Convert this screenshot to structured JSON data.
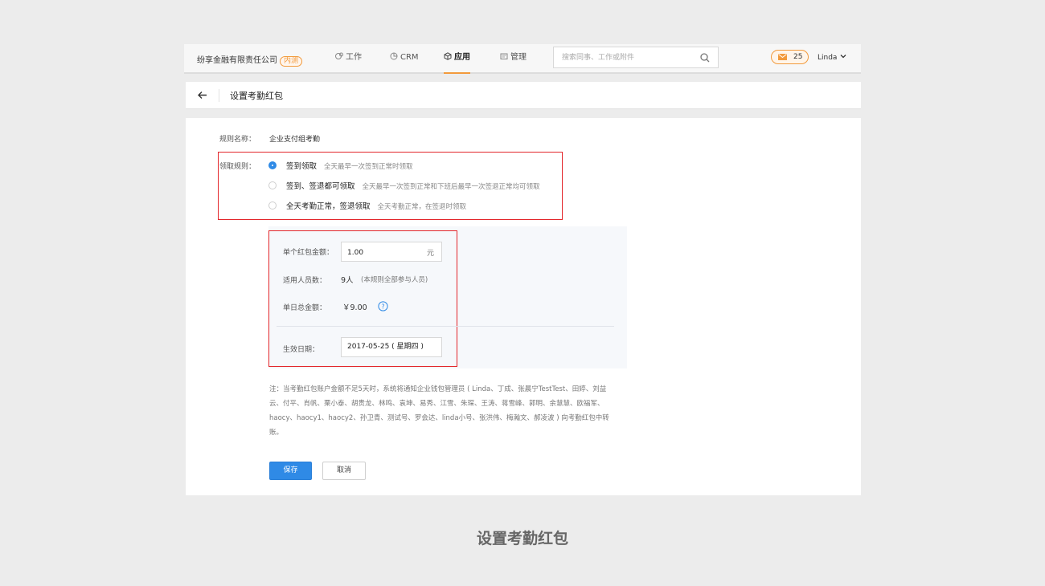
{
  "topbar": {
    "company": "纷享金融有限责任公司",
    "company_tag": "内测",
    "nav": [
      {
        "label": "工作",
        "icon": "work-icon"
      },
      {
        "label": "CRM",
        "icon": "crm-icon"
      },
      {
        "label": "应用",
        "icon": "app-icon",
        "active": true
      },
      {
        "label": "管理",
        "icon": "manage-icon"
      }
    ],
    "search_placeholder": "搜索同事、工作或附件",
    "mail_count": "25",
    "user_name": "Linda"
  },
  "page": {
    "title": "设置考勤红包"
  },
  "form": {
    "rule_name_label": "规则名称：",
    "rule_name_value": "企业支付组考勤",
    "receive_rule_label": "领取规则：",
    "options": [
      {
        "name": "签到领取",
        "desc": "全天最早一次签到正常时领取",
        "selected": true
      },
      {
        "name": "签到、签退都可领取",
        "desc": "全天最早一次签到正常和下班后最早一次签退正常均可领取",
        "selected": false
      },
      {
        "name": "全天考勤正常，签退领取",
        "desc": "全天考勤正常，在签退时领取",
        "selected": false
      }
    ],
    "amount_label": "单个红包金额：",
    "amount_value": "1.00",
    "amount_unit": "元",
    "people_label": "适用人员数：",
    "people_value": "9人",
    "people_note": "(本规则全部参与人员)",
    "daily_total_label": "单日总金额：",
    "daily_total_value": "￥9.00",
    "effective_date_label": "生效日期：",
    "effective_date_value": "2017-05-25 ( 星期四 )",
    "note_lines": [
      "注：当考勤红包账户金额不足5天时，系统将通知企业钱包管理员 ( Linda、丁成、张晨宁TestTest、田婷、刘益",
      "云、付平、肖帆、栗小泰、胡贵龙、林鸣、袁坤、易秀、江雪、朱琛、王涛、蒋雪峰、郭明、余慧慧、欧福军、",
      "haocy、haocy1、haocy2、孙卫青、测试号、罗会达、linda小号、张洪伟、梅瀚文、郝凌波 ) 向考勤红包中转",
      "账。"
    ],
    "save_label": "保存",
    "cancel_label": "取消"
  },
  "caption": "设置考勤红包",
  "colors": {
    "accent_blue": "#2f8ae6",
    "accent_orange": "#f29a3c",
    "highlight_red": "#e3262b"
  }
}
